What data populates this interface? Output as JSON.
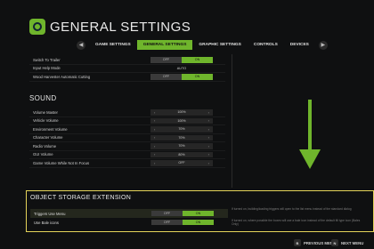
{
  "header": {
    "title": "GENERAL SETTINGS"
  },
  "tabs": {
    "prev_key": "Q",
    "next_key": "E",
    "items": [
      {
        "label": "GAME SETTINGS",
        "active": false
      },
      {
        "label": "GENERAL SETTINGS",
        "active": true
      },
      {
        "label": "GRAPHIC SETTINGS",
        "active": false
      },
      {
        "label": "CONTROLS",
        "active": false
      },
      {
        "label": "DEVICES",
        "active": false
      }
    ]
  },
  "general": {
    "rows": [
      {
        "label": "Switch To Trailer",
        "type": "toggle",
        "off": "OFF",
        "on": "ON",
        "value": "ON"
      },
      {
        "label": "Input Help Mode",
        "type": "plain",
        "value": "AUTO"
      },
      {
        "label": "Wood Harvester Automatic Cutting",
        "type": "toggle",
        "off": "OFF",
        "on": "ON",
        "value": "ON"
      }
    ]
  },
  "sound": {
    "title": "SOUND",
    "rows": [
      {
        "label": "Volume Master",
        "value": "100%"
      },
      {
        "label": "Vehicle Volume",
        "value": "100%"
      },
      {
        "label": "Environment Volume",
        "value": "70%"
      },
      {
        "label": "Character Volume",
        "value": "70%"
      },
      {
        "label": "Radio Volume",
        "value": "70%"
      },
      {
        "label": "GUI Volume",
        "value": "80%"
      },
      {
        "label": "Game Volume While Not In Focus",
        "value": "OFF"
      }
    ]
  },
  "storage": {
    "title": "OBJECT STORAGE EXTENSION",
    "rows": [
      {
        "label": "Triggers Use Menu",
        "off": "OFF",
        "on": "ON",
        "value": "ON",
        "desc": "If turned on, building/loading triggers will open to the list menu instead of the standard dialog"
      },
      {
        "label": "Use Bale icons",
        "off": "OFF",
        "on": "ON",
        "value": "ON",
        "desc": "If turned on, where possible the boxes will use a bale icon instead of the default fill type icon (Bales Only)"
      }
    ]
  },
  "footer": {
    "prev_key": "B",
    "prev_label": "PREVIOUS MENU",
    "next_key": "N",
    "next_label": "NEXT MENU"
  },
  "colors": {
    "accent": "#6fb52c",
    "highlight_border": "#e4d35a",
    "arrow": "#6fb52c"
  }
}
